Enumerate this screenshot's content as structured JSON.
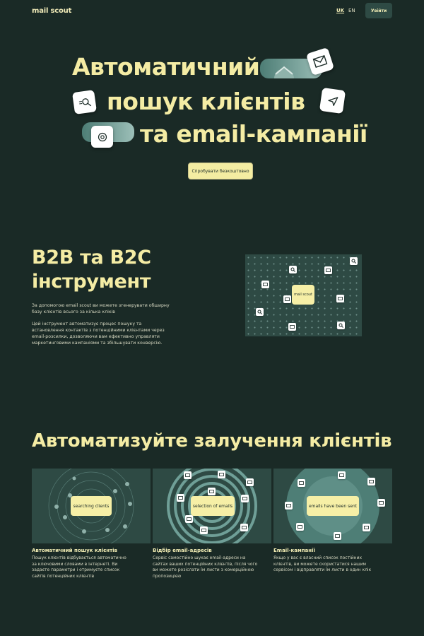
{
  "header": {
    "logo": "mail scout",
    "languages": [
      {
        "code": "UK",
        "active": true
      },
      {
        "code": "EN",
        "active": false
      }
    ],
    "login_label": "Увійти"
  },
  "hero": {
    "line1": "Автоматичний",
    "line2": "пошук клієнтів",
    "line3": "та email-кампанії",
    "cta_label": "Спробувати безкоштовно"
  },
  "b2b": {
    "title_line1": "B2B та B2C",
    "title_line2": "інструмент",
    "para1": "За допомогою email scout ви можете згенерувати обширну базу клієнтів всього за кілька кліків",
    "para2": "Цей інструмент автоматизує процес пошуку та встановлення контактів з потенційними клієнтами через email-розсилки, дозволяючи вам ефективно управляти маркетинговими кампаніями та збільшувати конверсію.",
    "panel_label": "mail scout"
  },
  "automate": {
    "title": "Автоматизуйте залучення клієнтів",
    "cards": [
      {
        "badge": "searching clients",
        "title": "Автоматичний пошук клієнтів",
        "text": "Пошук клієнтів відбувається автоматично за ключовими словами в інтернеті. Ви задаєте параметри і отримуєте список сайтів потенційних клієнтів"
      },
      {
        "badge": "selection of emails",
        "title": "Відбір email-адресів",
        "text": "Сервіс самостійно шукає email-адреси на сайтах ваших потенційних клієнтів, після чого ви можете розіслати їм листи з комерційною пропозицією"
      },
      {
        "badge": "emails have been sent",
        "title": "Email-кампанії",
        "text": "Якщо у вас є власний список постійних клієнтів, ви можете скористатися нашим сервісом і відправляти їм листи в один клік"
      }
    ]
  },
  "colors": {
    "background": "#1a2a26",
    "panel": "#2e4a44",
    "accent": "#f4eca4"
  },
  "icons": [
    "mail-icon",
    "search-icon",
    "send-icon",
    "at-icon"
  ]
}
